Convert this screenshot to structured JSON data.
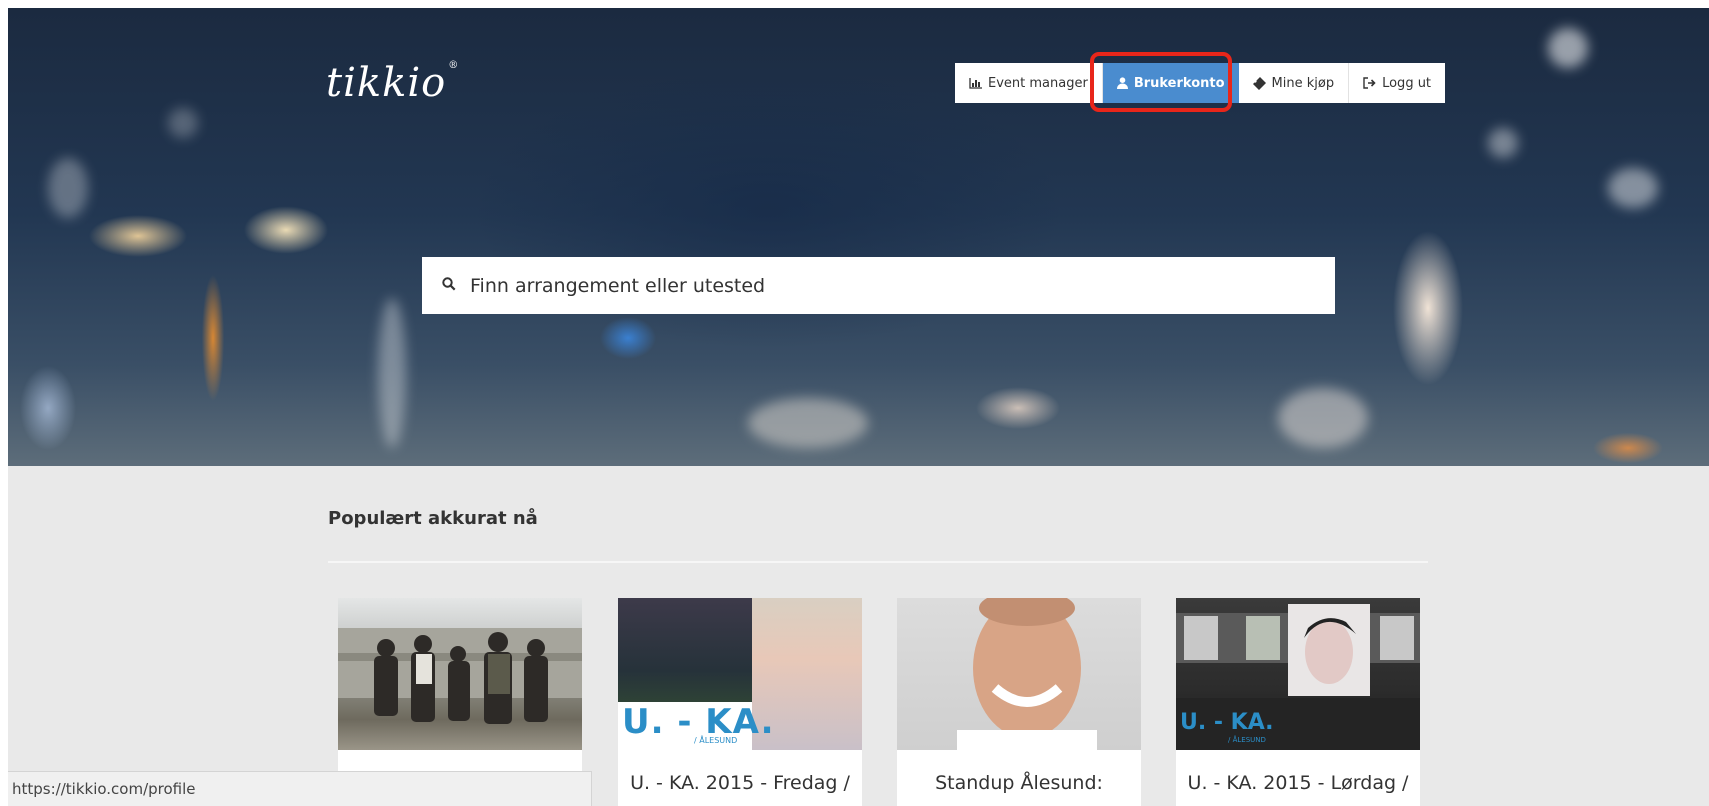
{
  "brand": {
    "logo_text": "tikkio",
    "mark": "®"
  },
  "nav": {
    "items": [
      {
        "label": "Event manager",
        "icon": "bar-chart-icon"
      },
      {
        "label": "Brukerkonto",
        "icon": "user-icon",
        "active": true
      },
      {
        "label": "Mine kjøp",
        "icon": "ticket-icon"
      },
      {
        "label": "Logg ut",
        "icon": "logout-icon"
      }
    ],
    "highlighted": "Brukerkonto"
  },
  "search": {
    "placeholder": "Finn arrangement eller utested",
    "value": ""
  },
  "popular": {
    "title": "Populært akkurat nå",
    "cards": [
      {
        "caption": ""
      },
      {
        "caption": "U. - KA. 2015 - Fredag /",
        "badge": "U. - KA.",
        "badge_sub": "/ ÅLESUND"
      },
      {
        "caption": "Standup Ålesund:"
      },
      {
        "caption": "U. - KA. 2015 - Lørdag /",
        "badge": "U. - KA.",
        "badge_sub": "/ ÅLESUND"
      }
    ]
  },
  "status_url": "https://tikkio.com/profile",
  "colors": {
    "accent": "#4a8ccf",
    "highlight": "#e8261a",
    "content_bg": "#e9e9e9"
  }
}
